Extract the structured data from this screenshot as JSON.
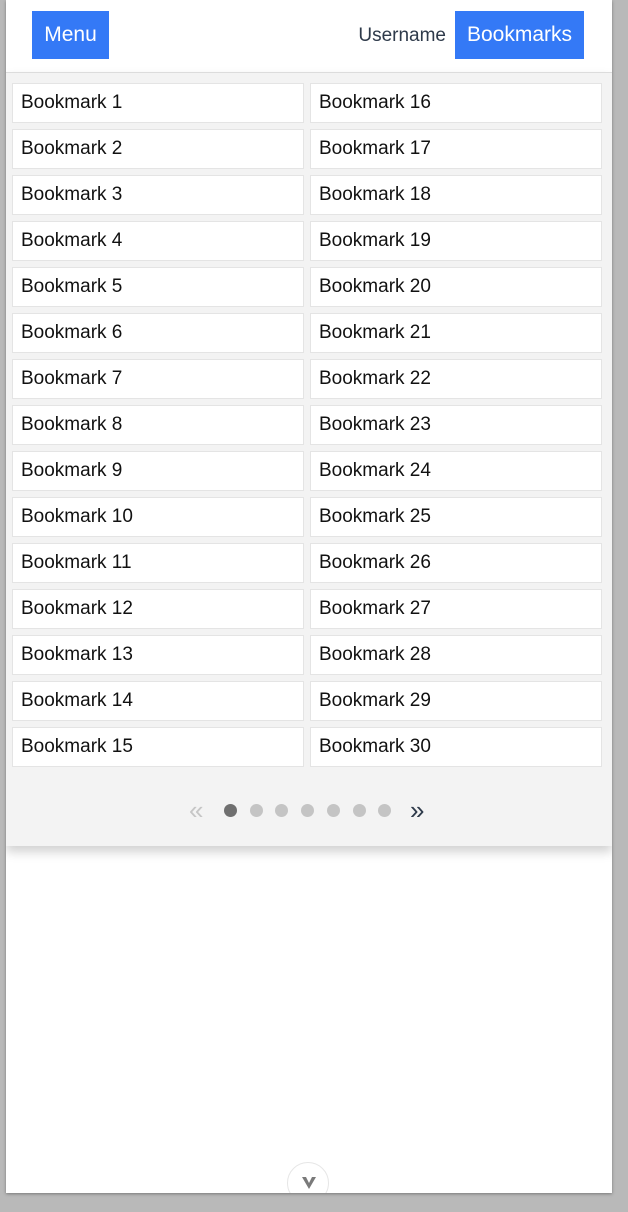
{
  "header": {
    "menu_label": "Menu",
    "username": "Username",
    "bookmarks_label": "Bookmarks"
  },
  "bookmarks": [
    "Bookmark 1",
    "Bookmark 2",
    "Bookmark 3",
    "Bookmark 4",
    "Bookmark 5",
    "Bookmark 6",
    "Bookmark 7",
    "Bookmark 8",
    "Bookmark 9",
    "Bookmark 10",
    "Bookmark 11",
    "Bookmark 12",
    "Bookmark 13",
    "Bookmark 14",
    "Bookmark 15",
    "Bookmark 16",
    "Bookmark 17",
    "Bookmark 18",
    "Bookmark 19",
    "Bookmark 20",
    "Bookmark 21",
    "Bookmark 22",
    "Bookmark 23",
    "Bookmark 24",
    "Bookmark 25",
    "Bookmark 26",
    "Bookmark 27",
    "Bookmark 28",
    "Bookmark 29",
    "Bookmark 30"
  ],
  "pagination": {
    "prev_label": "«",
    "next_label": "»",
    "page_count": 7,
    "current_page": 1
  },
  "colors": {
    "accent": "#3479f6",
    "panel_bg": "#f3f3f3",
    "dot_active": "#6f6f6f",
    "dot_inactive": "#c4c4c4"
  },
  "icons": {
    "scroll_down": "chevron-down-icon"
  }
}
